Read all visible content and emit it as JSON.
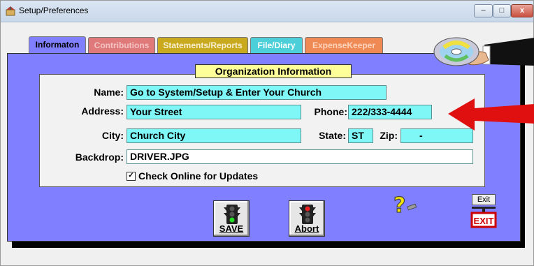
{
  "window": {
    "title": "Setup/Preferences",
    "min_glyph": "–",
    "max_glyph": "□",
    "close_glyph": "x"
  },
  "tabs": [
    {
      "label": "Informaton",
      "color": "#7f7fff"
    },
    {
      "label": "Contributions",
      "color": "#e07a7a"
    },
    {
      "label": "Statements/Reports",
      "color": "#c9a91e"
    },
    {
      "label": "File/Diary",
      "color": "#4ccfd9"
    },
    {
      "label": "ExpenseKeeper",
      "color": "#ef8a55"
    }
  ],
  "section_title": "Organization Information",
  "form": {
    "name_label": "Name:",
    "name_value": "Go to System/Setup & Enter Your Church",
    "address_label": "Address:",
    "address_value": "Your Street",
    "phone_label": "Phone:",
    "phone_value": "222/333-4444",
    "city_label": "City:",
    "city_value": "Church City",
    "state_label": "State:",
    "state_value": "ST",
    "zip_label": "Zip:",
    "zip_value": "-",
    "backdrop_label": "Backdrop:",
    "backdrop_value": "DRIVER.JPG",
    "check_online_label": "Check Online for Updates",
    "check_online_checked": true
  },
  "buttons": {
    "save_label": "SAVE",
    "abort_label": "Abort",
    "exit_label": "Exit",
    "exit_sign": "EXIT"
  },
  "colors": {
    "panel": "#7f7fff",
    "field": "#7ff7f7",
    "arrow": "#e01010"
  }
}
